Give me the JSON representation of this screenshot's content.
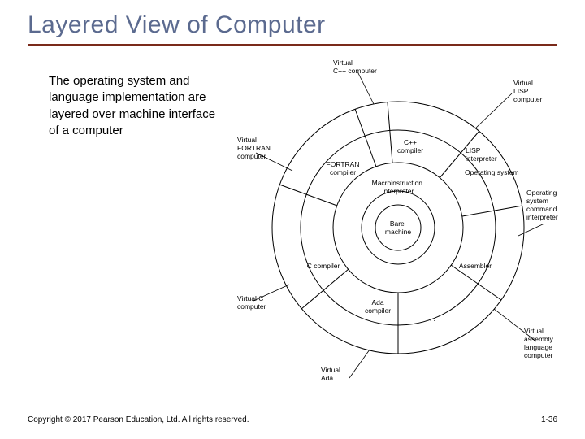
{
  "slide": {
    "title": "Layered View of Computer",
    "body": "The operating system and language implementation are layered over machine interface of a computer",
    "copyright": "Copyright © 2017 Pearson Education, Ltd. All rights reserved.",
    "pagenum": "1-36"
  },
  "diagram": {
    "center": "Bare machine",
    "ring1": "Macroinstruction interpreter",
    "ring2_segments": [
      "C++ compiler",
      "Operating system",
      "FORTRAN compiler",
      "C compiler",
      "Ada compiler",
      "Assembler",
      "LISP interpreter"
    ],
    "outer_segments": [
      "Virtual C++ computer",
      "Virtual LISP computer",
      "Virtual FORTRAN computer",
      "Operating system command interpreter",
      "Virtual C computer",
      "Virtual assembly language computer",
      "Virtual Ada computer"
    ],
    "dots": ". . ."
  }
}
